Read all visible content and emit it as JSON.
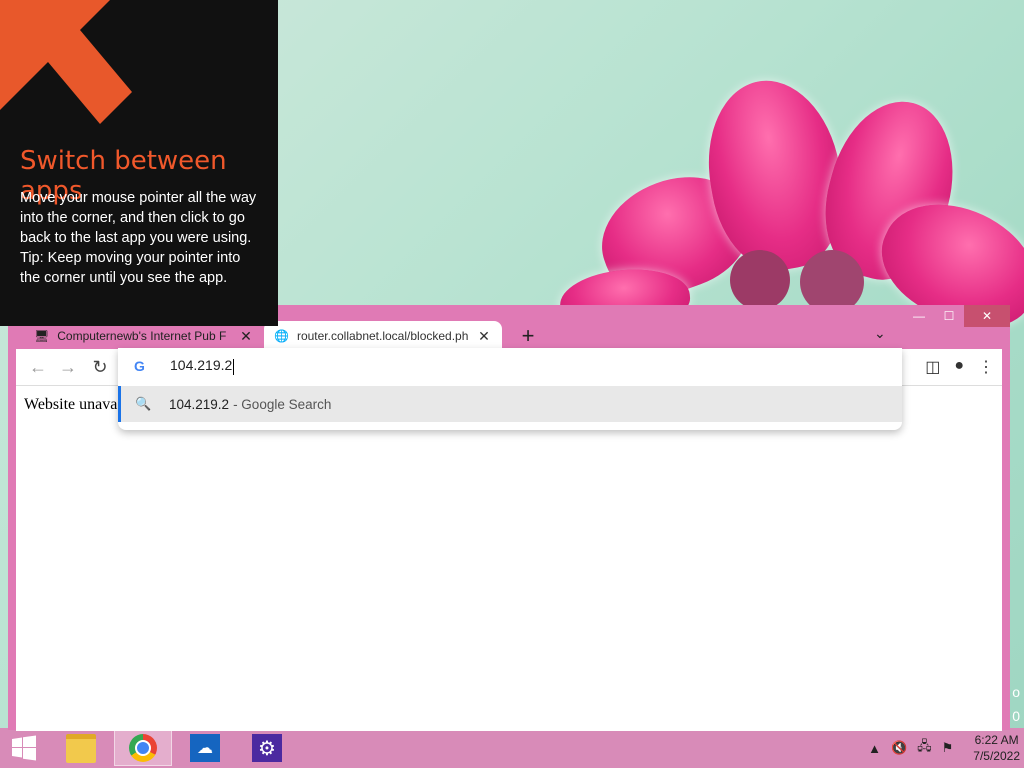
{
  "switch_apps": {
    "title": "Switch between apps",
    "body": "Move your mouse pointer all the way into the corner, and then click to go back to the last app you were using.",
    "tip": "Tip: Keep moving your pointer into the corner until you see the app."
  },
  "browser": {
    "tabs": [
      {
        "title": "Computernewb's Internet Pub F",
        "active": false
      },
      {
        "title": "router.collabnet.local/blocked.ph",
        "active": true
      }
    ],
    "omnibox": {
      "value": "104.219.2",
      "suggestion": "104.219.2",
      "suggestion_sub": "- Google Search"
    },
    "page_text": "Website unava"
  },
  "taskbar": {
    "apps": [
      "file-explorer-icon",
      "chrome-icon",
      "onedrive-icon",
      "settings-icon"
    ],
    "time": "6:22 AM",
    "date": "7/5/2022"
  },
  "edge_chars": [
    "o",
    "0"
  ]
}
